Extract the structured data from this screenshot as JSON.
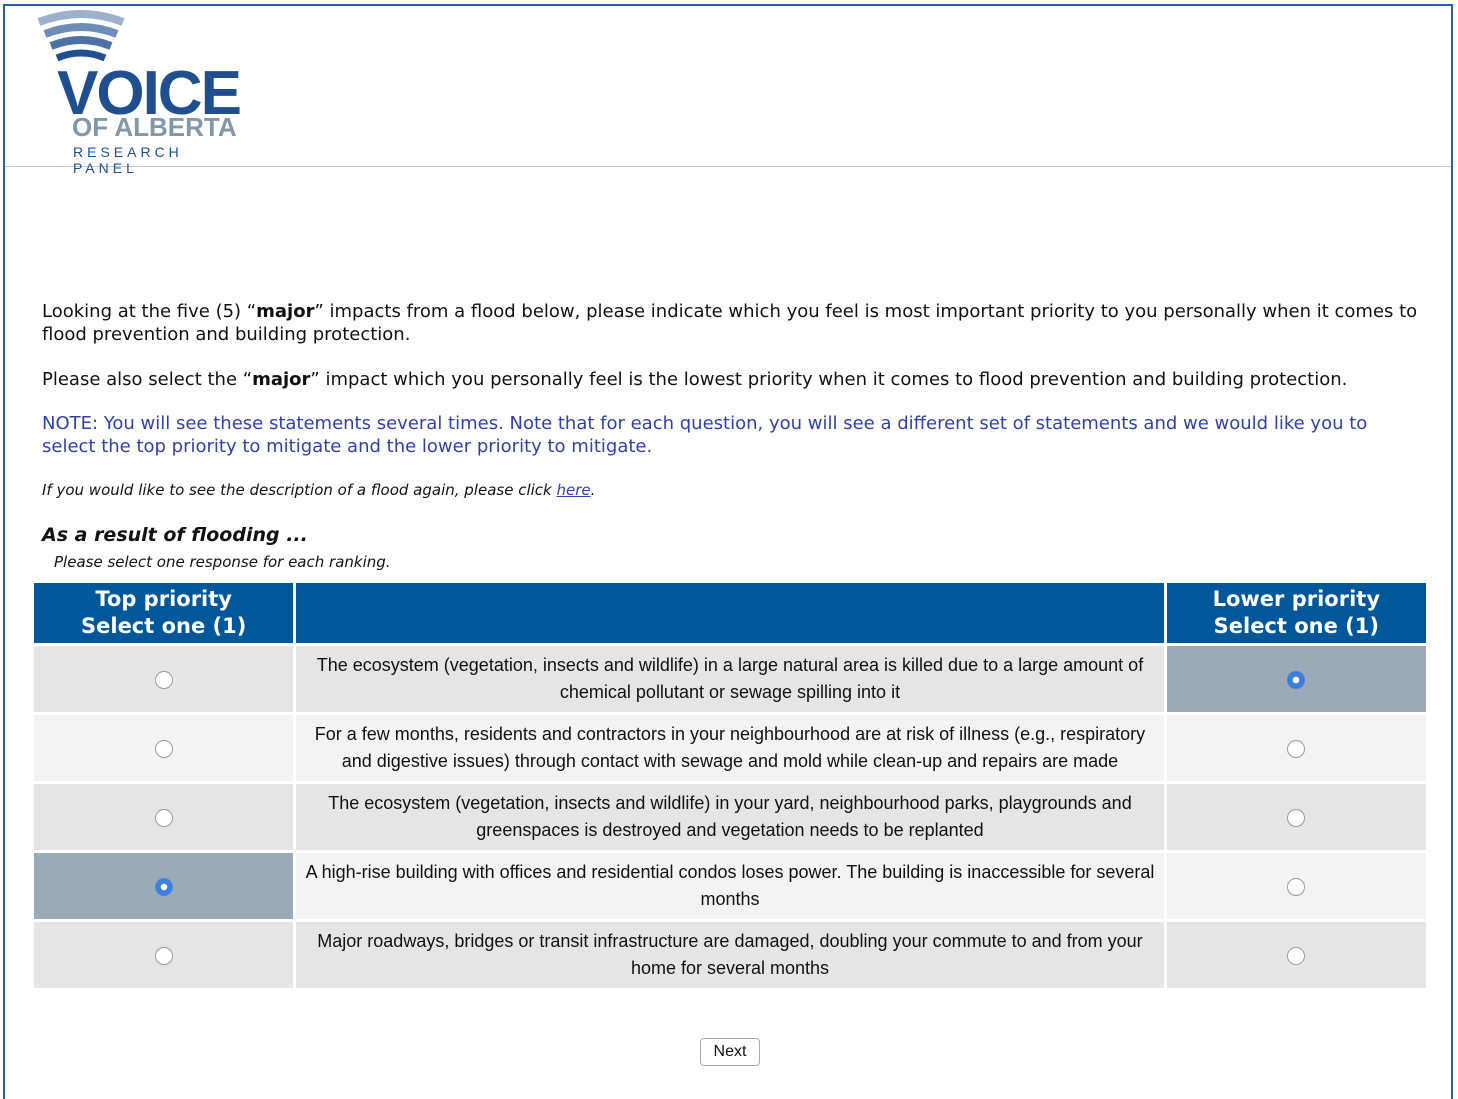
{
  "logo": {
    "line1": "VOICE",
    "line2": "OF ALBERTA",
    "line3": "RESEARCH PANEL",
    "colors": {
      "primary": "#1f4f8f",
      "secondary": "#7f97a9"
    }
  },
  "intro": {
    "p1_a": "Looking at the five (5) “",
    "p1_bold": "major",
    "p1_b": "” impacts from a flood below, please indicate which you feel is most important priority to you personally when it comes to flood prevention and building protection.",
    "p2_a": "Please also select the “",
    "p2_bold": "major",
    "p2_b": "” impact which you personally feel is the lowest priority when it comes to flood prevention and building protection.",
    "note": "NOTE: You will see these statements several times. Note that for each question, you will see a different set of statements and we would like you to select the top priority to mitigate and the lower priority to mitigate.",
    "desc_text": "If you would like to see the description of a flood again, please click ",
    "desc_link": "here",
    "desc_end": "."
  },
  "question": {
    "heading": "As a result of flooding ...",
    "instruction": "Please select one response for each ranking."
  },
  "table": {
    "header_left_1": "Top priority",
    "header_left_2": "Select one (1)",
    "header_mid": "",
    "header_right_1": "Lower priority",
    "header_right_2": "Select one (1)",
    "rows": [
      {
        "text": "The ecosystem (vegetation, insects and wildlife) in a large natural area is killed due to a large amount of chemical pollutant or sewage spilling into it",
        "top": false,
        "lower": true
      },
      {
        "text": "For a few months, residents and contractors in your neighbourhood are at risk of illness (e.g., respiratory and digestive issues) through contact with sewage and mold while clean-up and repairs are made",
        "top": false,
        "lower": false
      },
      {
        "text": "The ecosystem (vegetation, insects and wildlife) in your yard, neighbourhood parks, playgrounds and greenspaces is destroyed and vegetation needs to be replanted",
        "top": false,
        "lower": false
      },
      {
        "text": "A high-rise building with offices and residential condos loses power. The building is inaccessible for several months",
        "top": true,
        "lower": false
      },
      {
        "text": "Major roadways, bridges or transit infrastructure are damaged, doubling your commute to and from your home for several months",
        "top": false,
        "lower": false
      }
    ]
  },
  "footer": {
    "next_label": "Next"
  },
  "colors": {
    "header_bg": "#00579a",
    "selected_bg": "#9aaab8",
    "note_text": "#2f3fae",
    "frame": "#2a5ea8"
  }
}
